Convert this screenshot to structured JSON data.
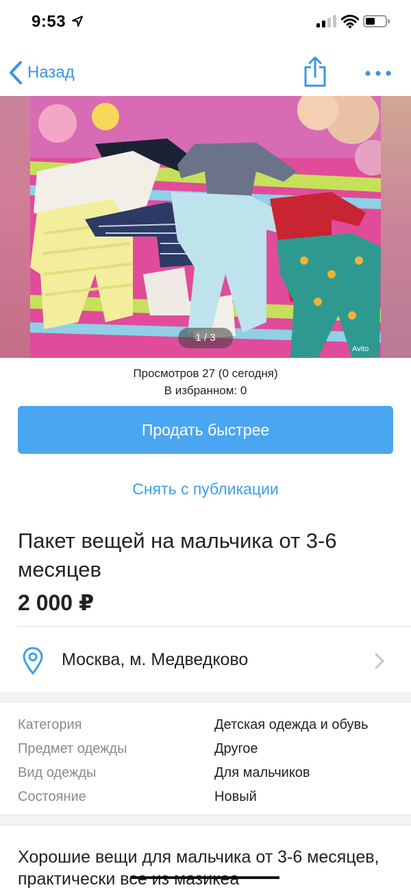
{
  "status_bar": {
    "time": "9:53"
  },
  "nav": {
    "back_label": "Назад"
  },
  "photo": {
    "pager": "1 / 3",
    "watermark": "Avito"
  },
  "stats": {
    "views": "Просмотров 27 (0 сегодня)",
    "favorites": "В избранном: 0"
  },
  "actions": {
    "sell_faster": "Продать быстрее",
    "unpublish": "Снять с публикации"
  },
  "listing": {
    "title": "Пакет вещей на мальчика от 3-6 месяцев",
    "price": "2 000 ₽",
    "location": "Москва, м. Медведково"
  },
  "params": [
    {
      "key": "Категория",
      "value": "Детская одежда и обувь"
    },
    {
      "key": "Предмет одежды",
      "value": "Другое"
    },
    {
      "key": "Вид одежды",
      "value": "Для мальчиков"
    },
    {
      "key": "Состояние",
      "value": "Новый"
    }
  ],
  "description": "Хорошие вещи для мальчика от 3-6 месяцев, практически все из мазикеа",
  "colors": {
    "accent": "#3a94e3",
    "button": "#4ba6f1"
  },
  "icons": {
    "location_arrow": "location-arrow-icon",
    "signal": "signal-icon",
    "wifi": "wifi-icon",
    "battery": "battery-icon",
    "back": "chevron-left-icon",
    "share": "share-icon",
    "more": "more-dots-icon",
    "pin": "map-pin-icon",
    "chevron": "chevron-right-icon"
  }
}
